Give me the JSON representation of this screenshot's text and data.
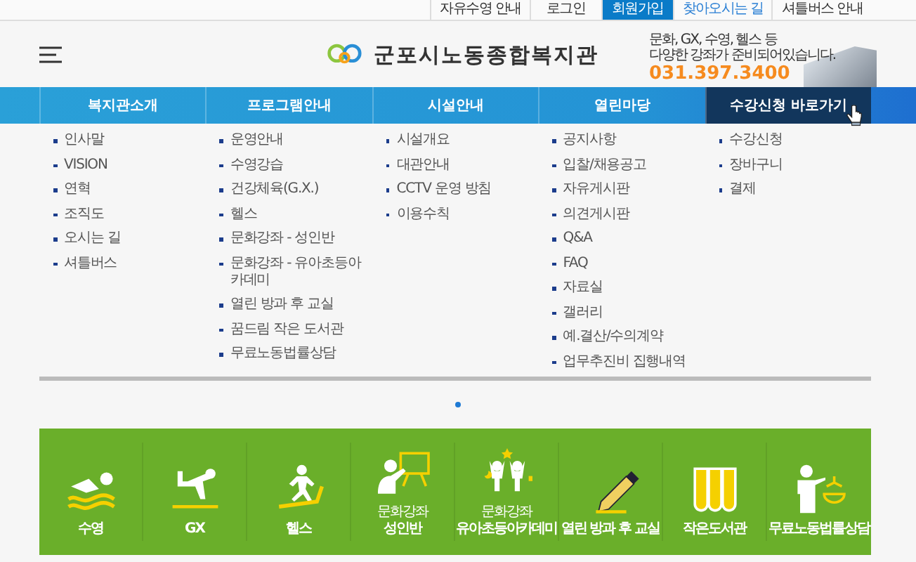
{
  "top_links": [
    {
      "label": "자유수영 안내",
      "kind": "plain"
    },
    {
      "label": "로그인",
      "kind": "plain"
    },
    {
      "label": "회원가입",
      "kind": "filled"
    },
    {
      "label": "찾아오시는 길",
      "kind": "link"
    },
    {
      "label": "셔틀버스 안내",
      "kind": "plain"
    }
  ],
  "header": {
    "logo_text": "군포시노동종합복지관",
    "promo_lines": [
      "문화, GX, 수영, 헬스 등",
      "다양한 강좌가 준비되어있습니다."
    ],
    "phone": "031.397.3400"
  },
  "nav": [
    {
      "label": "복지관소개",
      "selected": false,
      "items": [
        "인사말",
        "VISION",
        "연혁",
        "조직도",
        "오시는 길",
        "셔틀버스"
      ]
    },
    {
      "label": "프로그램안내",
      "selected": false,
      "items": [
        "운영안내",
        "수영강습",
        "건강체육(G.X.)",
        "헬스",
        "문화강좌 - 성인반",
        "문화강좌 - 유아초등아카데미",
        "열린 방과 후 교실",
        "꿈드림 작은 도서관",
        "무료노동법률상담"
      ]
    },
    {
      "label": "시설안내",
      "selected": false,
      "items": [
        "시설개요",
        "대관안내",
        "CCTV 운영 방침",
        "이용수칙"
      ]
    },
    {
      "label": "열린마당",
      "selected": false,
      "items": [
        "공지사항",
        "입찰/채용공고",
        "자유게시판",
        "의견게시판",
        "Q&A",
        "FAQ",
        "자료실",
        "갤러리",
        "예.결산/수의계약",
        "업무추진비 집행내역"
      ]
    },
    {
      "label": "수강신청 바로가기",
      "selected": true,
      "items": [
        "수강신청",
        "장바구니",
        "결제"
      ]
    }
  ],
  "tiles": [
    {
      "label": "수영"
    },
    {
      "label": "GX"
    },
    {
      "label": "헬스"
    },
    {
      "sublabel": "문화강좌",
      "label": "성인반"
    },
    {
      "sublabel": "문화강좌",
      "label": "유아초등아카데미"
    },
    {
      "label": "열린 방과 후 교실"
    },
    {
      "label": "작은도서관"
    },
    {
      "label": "무료노동법률상담"
    }
  ]
}
